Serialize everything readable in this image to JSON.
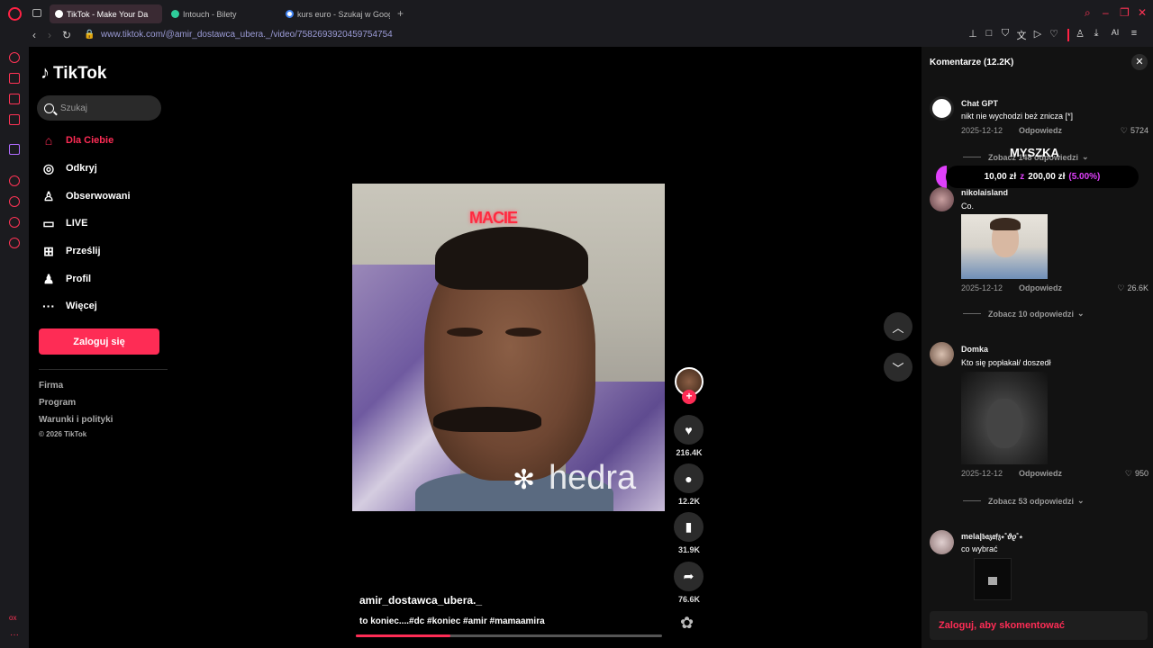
{
  "browser": {
    "tabs": [
      {
        "label": "TikTok - Make Your Da",
        "active": true
      },
      {
        "label": "Intouch - Bilety",
        "active": false
      },
      {
        "label": "kurs euro - Szukaj w Goog",
        "active": false
      }
    ],
    "url": "www.tiktok.com/@amir_dostawca_ubera._/video/7582693920459754754",
    "ai_label": "AI"
  },
  "tiktok": {
    "logo_text": "TikTok",
    "search_placeholder": "Szukaj",
    "menu": [
      {
        "label": "Dla Ciebie",
        "icon": "home-icon",
        "active": true
      },
      {
        "label": "Odkryj",
        "icon": "compass-icon",
        "active": false
      },
      {
        "label": "Obserwowani",
        "icon": "following-icon",
        "active": false
      },
      {
        "label": "LIVE",
        "icon": "live-icon",
        "active": false
      },
      {
        "label": "Prześlij",
        "icon": "upload-icon",
        "active": false
      },
      {
        "label": "Profil",
        "icon": "profile-icon",
        "active": false
      },
      {
        "label": "Więcej",
        "icon": "more-icon",
        "active": false
      }
    ],
    "login_button": "Zaloguj się",
    "footer_links": [
      "Firma",
      "Program",
      "Warunki i polityki"
    ],
    "copyright": "© 2026 TikTok"
  },
  "video": {
    "effect_text": "MACIE",
    "watermark": "hedra",
    "author": "amir_dostawca_ubera._",
    "caption": "to koniec....#dc #koniec #amir #mamaamira",
    "progress": 0.31,
    "likes": "216.4K",
    "comments": "12.2K",
    "saves": "31.9K",
    "shares": "76.6K"
  },
  "comments_panel": {
    "title": "Komentarze",
    "count": "(12.2K)",
    "reply_label": "Odpowiedz",
    "login_prompt": "Zaloguj, aby skomentować",
    "comments": [
      {
        "user": "Chat GPT",
        "text": "nikt nie wychodzi beż znicza [*]",
        "date": "2025-12-12",
        "likes": "5724",
        "replies": "Zobacz 148 odpowiedzi"
      },
      {
        "user": "nikolaisland",
        "text": "Co.",
        "date": "2025-12-12",
        "likes": "26.6K",
        "replies": "Zobacz 10 odpowiedzi"
      },
      {
        "user": "Domka",
        "text": "Kto się popłakał/ doszedł",
        "date": "2025-12-12",
        "likes": "950",
        "replies": "Zobacz 53 odpowiedzi"
      },
      {
        "user": "mela|𝔟𝔞𝔷𝔞𝔣𝔷⋆˚𝜗𝜚˚⋆",
        "text": "co wybrać"
      }
    ]
  },
  "overlay": {
    "label": "MYSZKA",
    "amount": "10,00 zł",
    "sep": "z",
    "goal": "200,00 zł",
    "percent": "(5.00%)"
  },
  "colors": {
    "accent": "#fe2c55",
    "opera": "#ff2244",
    "overlay": "#e040fb"
  }
}
